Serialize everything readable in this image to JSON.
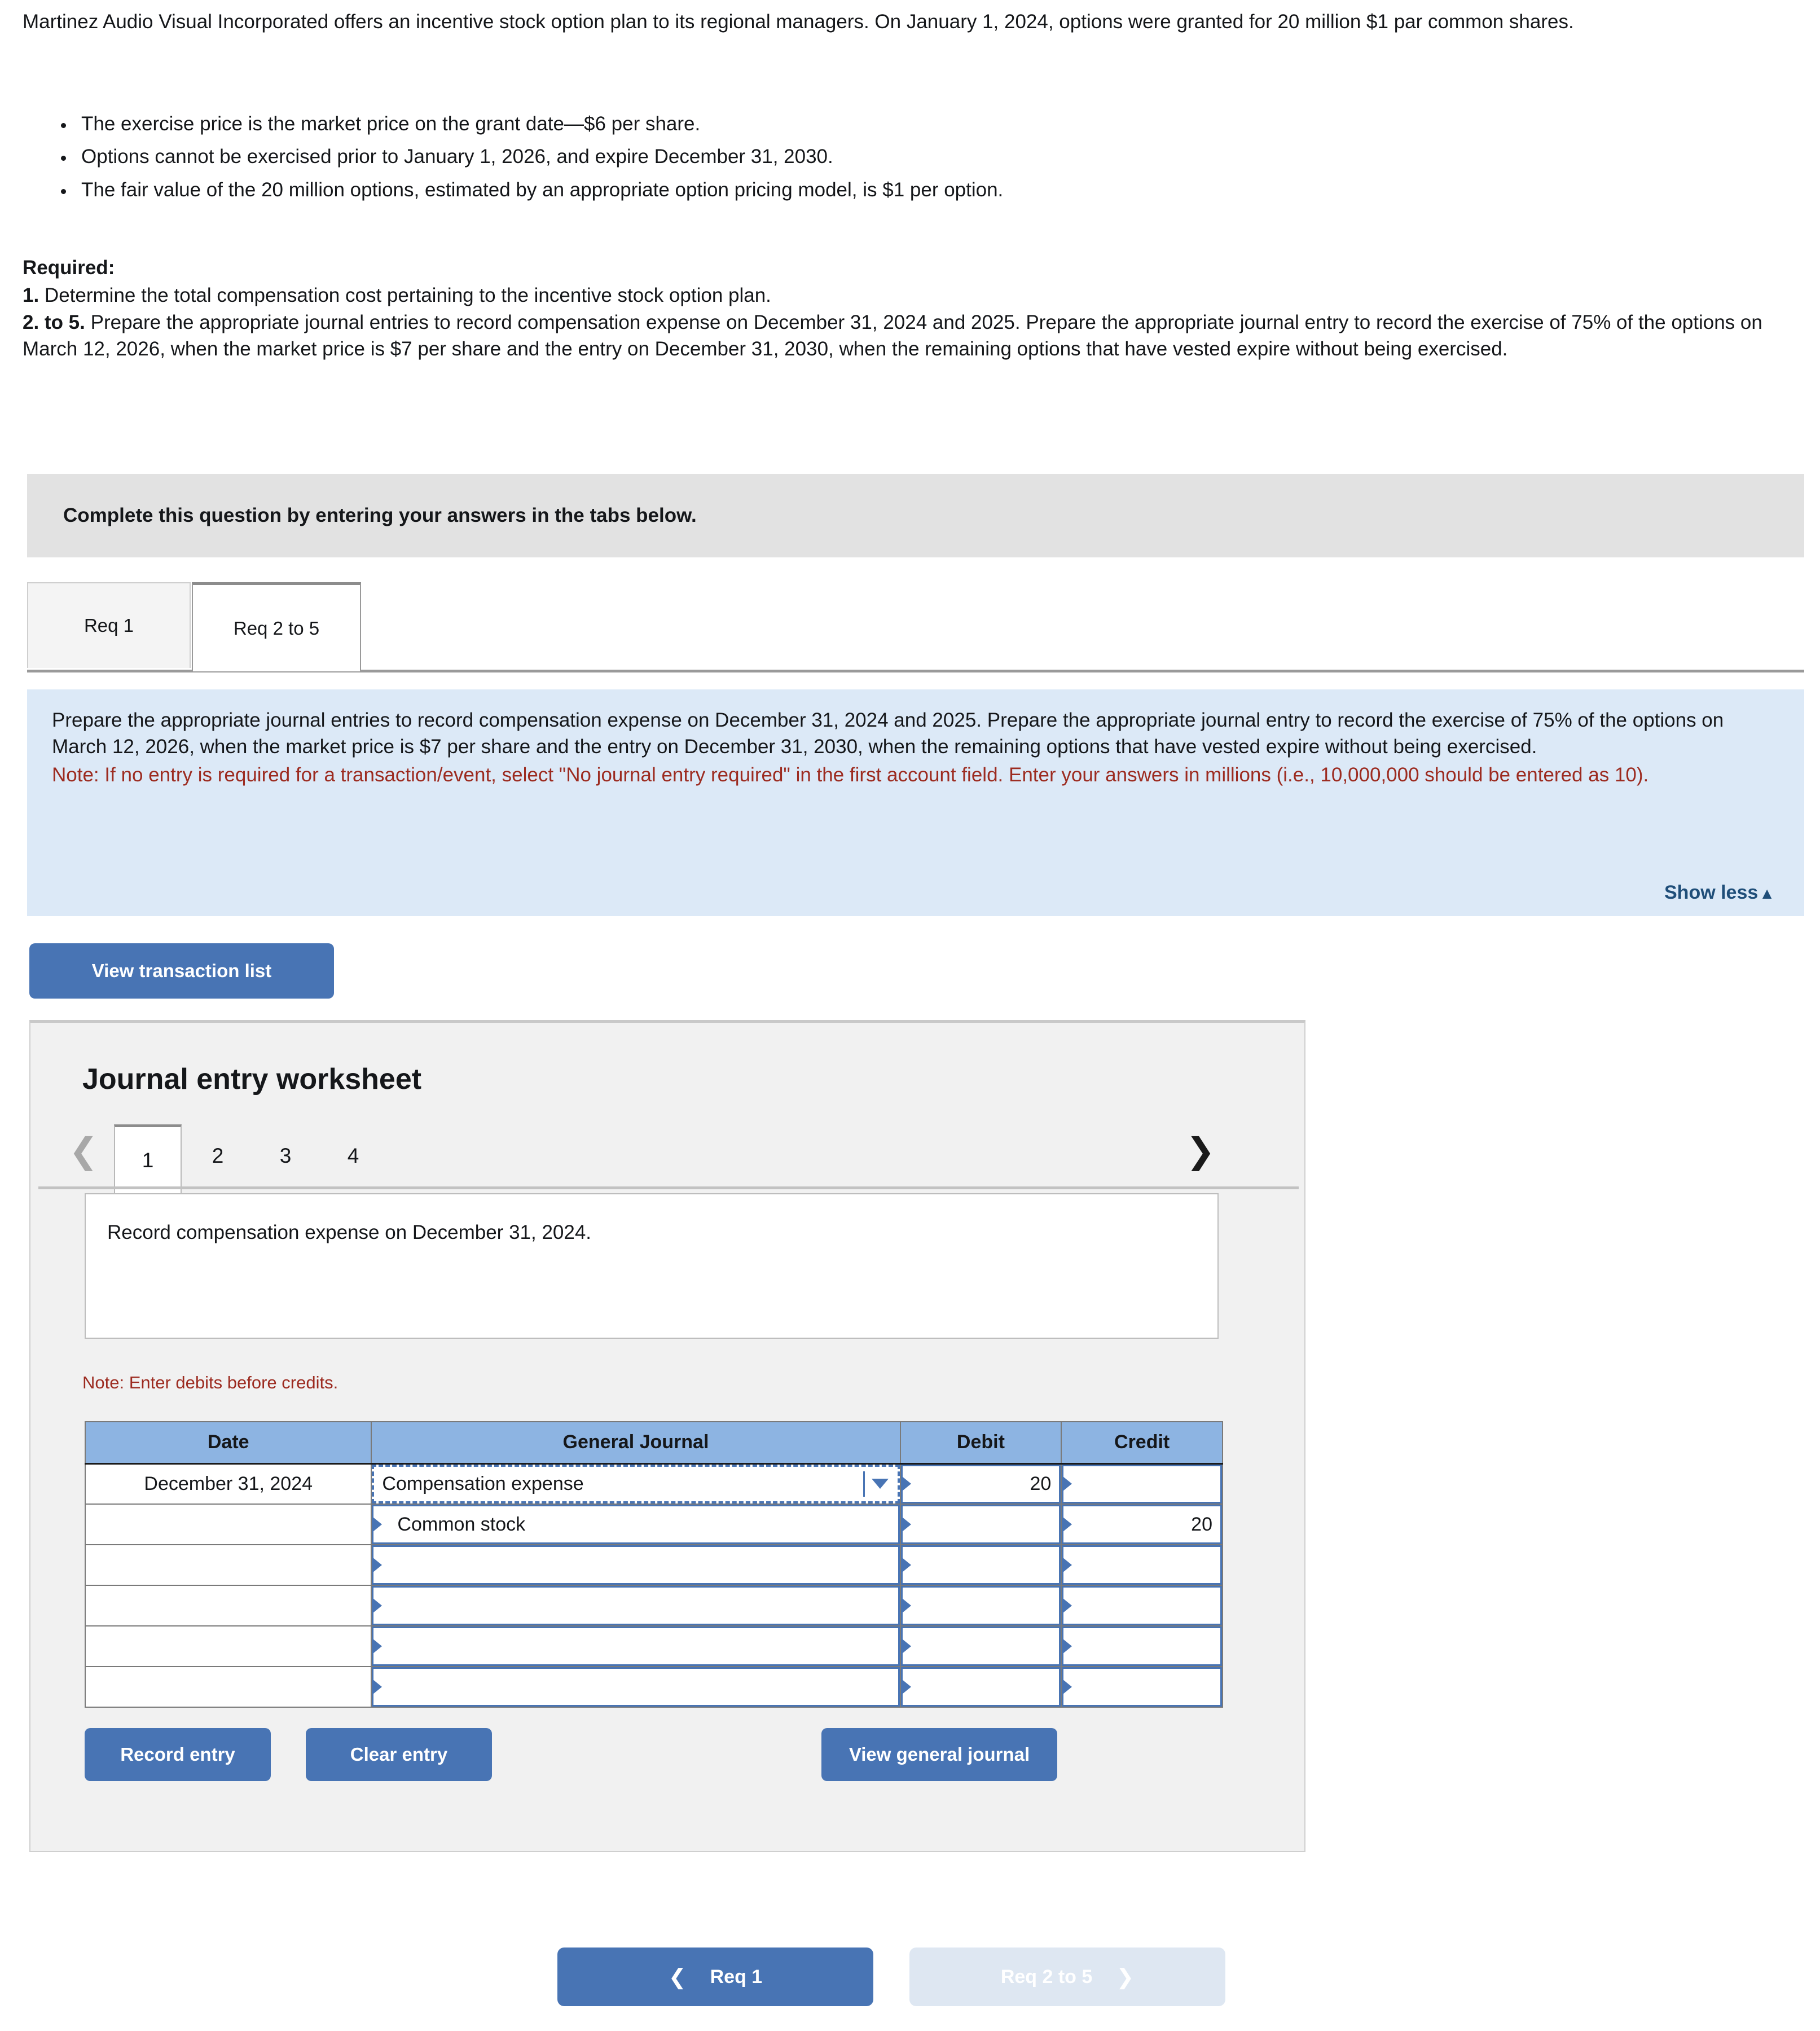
{
  "intro": {
    "paragraph": "Martinez Audio Visual Incorporated offers an incentive stock option plan to its regional managers. On January 1, 2024, options were granted for 20 million $1 par common shares.",
    "bullets": [
      "The exercise price is the market price on the grant date—$6 per share.",
      "Options cannot be exercised prior to January 1, 2026, and expire December 31, 2030.",
      "The fair value of the 20 million options, estimated by an appropriate option pricing model, is $1 per option."
    ]
  },
  "required": {
    "heading": "Required:",
    "item1_num": "1.",
    "item1_text": " Determine the total compensation cost pertaining to the incentive stock option plan.",
    "item2_num": "2. to 5.",
    "item2_text": " Prepare the appropriate journal entries to record compensation expense on December 31, 2024 and 2025. Prepare the appropriate journal entry to record the exercise of 75% of the options on March 12, 2026, when the market price is $7 per share and the entry on December 31, 2030, when the remaining options that have vested expire without being exercised."
  },
  "banner": {
    "text": "Complete this question by entering your answers in the tabs below."
  },
  "tabs": [
    {
      "label": "Req 1",
      "active": false
    },
    {
      "label": "Req 2 to 5",
      "active": true
    }
  ],
  "instruction_panel": {
    "body": "Prepare the appropriate journal entries to record compensation expense on December 31, 2024 and 2025. Prepare the appropriate journal entry to record the exercise of 75% of the options on March 12, 2026, when the market price is $7 per share and the entry on December 31, 2030, when the remaining options that have vested expire without being exercised.",
    "note": "Note: If no entry is required for a transaction/event, select \"No journal entry required\" in the first account field. Enter your answers in millions (i.e., 10,000,000 should be entered as 10).",
    "show_less_label": "Show less",
    "show_less_caret": "▲",
    "accent_color": "#1f4e79",
    "background_color": "#dce9f7",
    "note_color": "#9c2b20"
  },
  "view_transaction_list_label": "View transaction list",
  "worksheet": {
    "title": "Journal entry worksheet",
    "prev_arrow": "❮",
    "next_arrow": "❯",
    "pages": [
      "1",
      "2",
      "3",
      "4"
    ],
    "active_page": "1",
    "description": "Record compensation expense on December 31, 2024.",
    "debit_note": "Note: Enter debits before credits.",
    "table": {
      "headers": [
        "Date",
        "General Journal",
        "Debit",
        "Credit"
      ],
      "rows": [
        {
          "date": "December 31, 2024",
          "account": "Compensation expense",
          "indent": false,
          "selected": true,
          "dropdown": true,
          "debit": "20",
          "credit": ""
        },
        {
          "date": "",
          "account": "Common stock",
          "indent": true,
          "selected": false,
          "dropdown": false,
          "debit": "",
          "credit": "20"
        },
        {
          "date": "",
          "account": "",
          "indent": false,
          "selected": false,
          "dropdown": false,
          "debit": "",
          "credit": ""
        },
        {
          "date": "",
          "account": "",
          "indent": false,
          "selected": false,
          "dropdown": false,
          "debit": "",
          "credit": ""
        },
        {
          "date": "",
          "account": "",
          "indent": false,
          "selected": false,
          "dropdown": false,
          "debit": "",
          "credit": ""
        },
        {
          "date": "",
          "account": "",
          "indent": false,
          "selected": false,
          "dropdown": false,
          "debit": "",
          "credit": ""
        }
      ]
    },
    "buttons": {
      "record": "Record entry",
      "clear": "Clear entry",
      "view_general_journal": "View general journal"
    },
    "header_fill": "#8db4e2",
    "input_border": "#4874b4"
  },
  "bottom_nav": {
    "prev_label": "Req 1",
    "prev_arrow": "❮",
    "next_label": "Req 2 to 5",
    "next_arrow": "❯",
    "next_disabled": true
  },
  "colors": {
    "primary_button": "#4874b4",
    "disabled_button": "#dee7f2"
  }
}
